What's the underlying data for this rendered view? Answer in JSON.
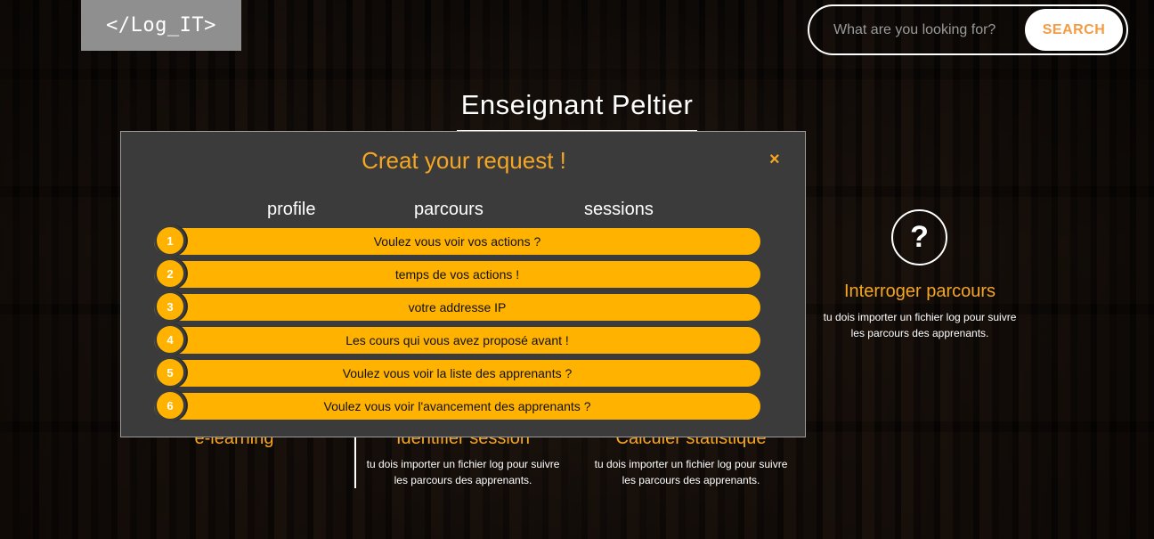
{
  "logo": {
    "text": "</Log_IT>"
  },
  "search": {
    "placeholder": "What are you looking for?",
    "button_label": "SEARCH"
  },
  "page_title": "Enseignant Peltier",
  "features": [
    {
      "title": "Interroger parcours",
      "desc_line1": "tu dois importer un fichier log pour suivre",
      "desc_line2": "les parcours des apprenants.",
      "icon": "?"
    },
    {
      "title": "e-learning"
    },
    {
      "title": "Identifier session",
      "desc_line1": "tu dois importer un fichier log pour suivre",
      "desc_line2": "les parcours des apprenants."
    },
    {
      "title": "Calculer statistique",
      "desc_line1": "tu dois importer un fichier log pour suivre",
      "desc_line2": "les parcours des apprenants."
    }
  ],
  "modal": {
    "title": "Creat your request !",
    "close": "×",
    "tabs": [
      "profile",
      "parcours",
      "sessions"
    ],
    "questions": [
      {
        "num": "1",
        "text": "Voulez vous voir vos actions ?"
      },
      {
        "num": "2",
        "text": "temps de vos actions !"
      },
      {
        "num": "3",
        "text": "votre addresse IP"
      },
      {
        "num": "4",
        "text": "Les cours qui vous avez proposé avant !"
      },
      {
        "num": "5",
        "text": "Voulez vous voir la liste des apprenants ?"
      },
      {
        "num": "6",
        "text": "Voulez vous voir l'avancement des apprenants ?"
      }
    ]
  },
  "colors": {
    "accent": "#f5a623",
    "question_bg": "#ffb300",
    "modal_bg": "#3b3b3b",
    "search_text": "#f39c43"
  }
}
